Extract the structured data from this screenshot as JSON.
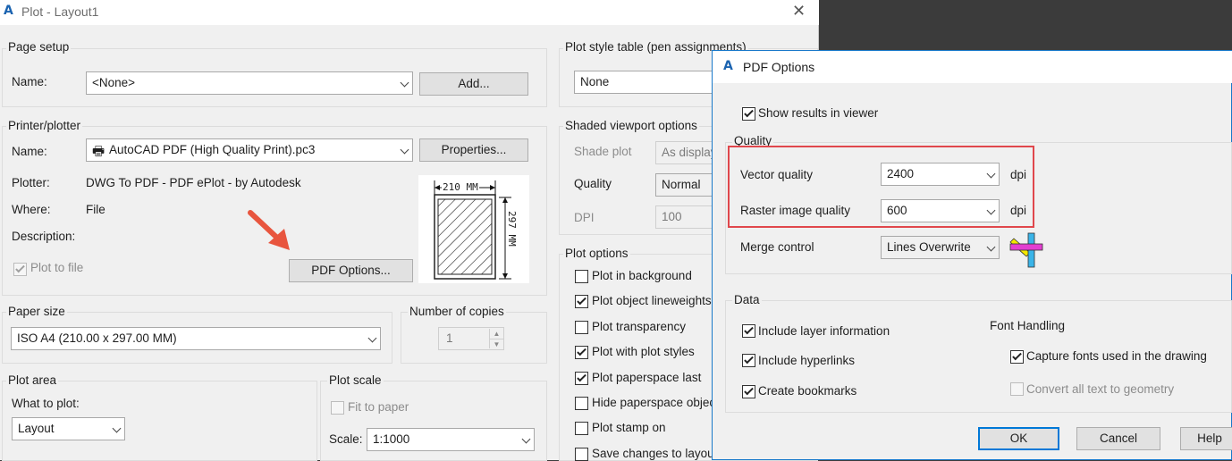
{
  "main": {
    "title": "Plot - Layout1",
    "close_glyph": "✕",
    "logo": "A",
    "page_setup": {
      "title": "Page setup",
      "name_label": "Name:",
      "name_value": "<None>",
      "add_button": "Add..."
    },
    "printer": {
      "title": "Printer/plotter",
      "name_label": "Name:",
      "name_value": "AutoCAD PDF (High Quality Print).pc3",
      "properties_button": "Properties...",
      "plotter_label": "Plotter:",
      "plotter_value": "DWG To PDF - PDF ePlot - by Autodesk",
      "where_label": "Where:",
      "where_value": "File",
      "description_label": "Description:",
      "plot_to_file_label": "Plot to file",
      "plot_to_file_checked": true,
      "pdf_options_button": "PDF Options...",
      "preview_width": "210 MM",
      "preview_height": "297 MM"
    },
    "paper_size": {
      "title": "Paper size",
      "value": "ISO A4 (210.00 x 297.00 MM)"
    },
    "copies": {
      "title": "Number of copies",
      "value": "1"
    },
    "plot_area": {
      "title": "Plot area",
      "what_label": "What to plot:",
      "value": "Layout"
    },
    "plot_scale": {
      "title": "Plot scale",
      "fit_label": "Fit to paper",
      "scale_label": "Scale:",
      "scale_value": "1:1000"
    },
    "style_table": {
      "title": "Plot style table (pen assignments)",
      "value": "None"
    },
    "shaded": {
      "title": "Shaded viewport options",
      "shade_label": "Shade plot",
      "shade_value": "As display",
      "quality_label": "Quality",
      "quality_value": "Normal",
      "dpi_label": "DPI",
      "dpi_value": "100"
    },
    "plot_options": {
      "title": "Plot options",
      "items": [
        {
          "label": "Plot in background",
          "checked": false
        },
        {
          "label": "Plot object lineweights",
          "checked": true
        },
        {
          "label": "Plot transparency",
          "checked": false
        },
        {
          "label": "Plot with plot styles",
          "checked": true
        },
        {
          "label": "Plot paperspace last",
          "checked": true
        },
        {
          "label": "Hide paperspace objects",
          "checked": false
        },
        {
          "label": "Plot stamp on",
          "checked": false
        },
        {
          "label": "Save changes to layout",
          "checked": false
        }
      ]
    }
  },
  "pdf": {
    "title": "PDF Options",
    "logo": "A",
    "show_results_label": "Show results in viewer",
    "show_results_checked": true,
    "quality_title": "Quality",
    "vector_label": "Vector quality",
    "vector_value": "2400",
    "vector_unit": "dpi",
    "raster_label": "Raster image quality",
    "raster_value": "600",
    "raster_unit": "dpi",
    "merge_label": "Merge control",
    "merge_value": "Lines Overwrite",
    "data_title": "Data",
    "include_layer_label": "Include layer information",
    "include_hyperlinks_label": "Include hyperlinks",
    "create_bookmarks_label": "Create bookmarks",
    "font_handling_title": "Font Handling",
    "capture_fonts_label": "Capture fonts used in the drawing",
    "convert_text_label": "Convert all text to geometry",
    "ok_button": "OK",
    "cancel_button": "Cancel",
    "help_button": "Help"
  },
  "colors": {
    "highlight": "#e0474c",
    "accent": "#0078d7",
    "arrow": "#e8553e"
  }
}
